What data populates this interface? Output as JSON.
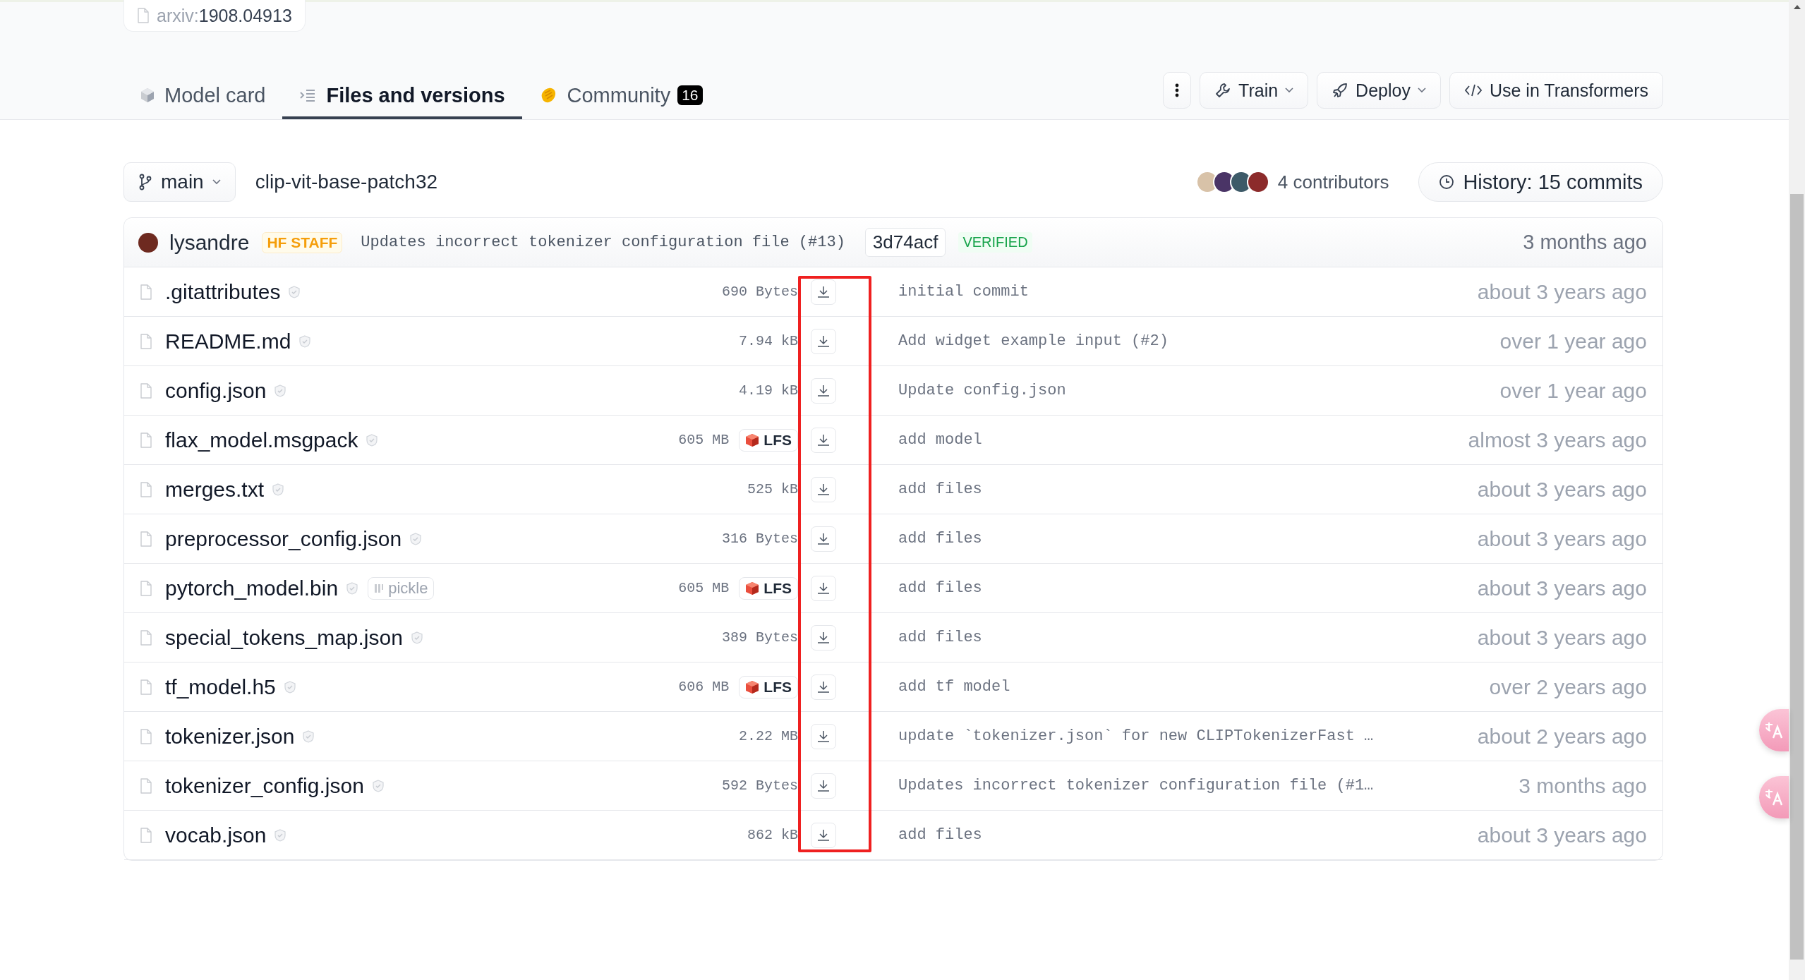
{
  "paper_chip": {
    "prefix": "arxiv:",
    "id": "1908.04913"
  },
  "tabs": [
    {
      "label": "Model card",
      "selected": false
    },
    {
      "label": "Files and versions",
      "selected": true
    },
    {
      "label": "Community",
      "badge": "16",
      "selected": false
    }
  ],
  "actions": [
    {
      "kind": "menu"
    },
    {
      "kind": "dropdown",
      "label": "Train"
    },
    {
      "kind": "dropdown",
      "label": "Deploy"
    },
    {
      "kind": "plain",
      "label": "Use in Transformers"
    }
  ],
  "branch": "main",
  "repo": "clip-vit-base-patch32",
  "contributors": {
    "label": "4 contributors",
    "avatars": [
      {
        "color": "#d8c2a8"
      },
      {
        "color": "#4a3466"
      },
      {
        "color": "#3d5a68"
      },
      {
        "color": "#8c2b2b"
      }
    ]
  },
  "history": "History: 15 commits",
  "last_commit": {
    "author": "lysandre",
    "badge": "HF STAFF",
    "message": "Updates incorrect tokenizer configuration file (#13)",
    "hash": "3d74acf",
    "verified": "VERIFIED",
    "time": "3 months ago"
  },
  "files": [
    {
      "name": ".gitattributes",
      "size": "690 Bytes",
      "message": "initial commit",
      "time": "about 3 years ago"
    },
    {
      "name": "README.md",
      "size": "7.94 kB",
      "message": "Add widget example input (#2)",
      "time": "over 1 year ago"
    },
    {
      "name": "config.json",
      "size": "4.19 kB",
      "message": "Update config.json",
      "time": "over 1 year ago"
    },
    {
      "name": "flax_model.msgpack",
      "size": "605 MB",
      "lfs_label": "LFS",
      "message": "add model",
      "time": "almost 3 years ago"
    },
    {
      "name": "merges.txt",
      "size": "525 kB",
      "message": "add files",
      "time": "about 3 years ago"
    },
    {
      "name": "preprocessor_config.json",
      "size": "316 Bytes",
      "message": "add files",
      "time": "about 3 years ago"
    },
    {
      "name": "pytorch_model.bin",
      "tag": "pickle",
      "size": "605 MB",
      "lfs_label": "LFS",
      "message": "add files",
      "time": "about 3 years ago"
    },
    {
      "name": "special_tokens_map.json",
      "size": "389 Bytes",
      "message": "add files",
      "time": "about 3 years ago"
    },
    {
      "name": "tf_model.h5",
      "size": "606 MB",
      "lfs_label": "LFS",
      "message": "add tf model",
      "time": "over 2 years ago"
    },
    {
      "name": "tokenizer.json",
      "size": "2.22 MB",
      "message": "update `tokenizer.json` for new CLIPTokenizerFast …",
      "time": "about 2 years ago"
    },
    {
      "name": "tokenizer_config.json",
      "size": "592 Bytes",
      "message": "Updates incorrect tokenizer configuration file (#1…",
      "time": "3 months ago"
    },
    {
      "name": "vocab.json",
      "size": "862 kB",
      "message": "add files",
      "time": "about 3 years ago"
    }
  ],
  "download_column_highlighted": true,
  "side_buttons": [
    {
      "kind": "translate"
    },
    {
      "kind": "translate"
    }
  ]
}
